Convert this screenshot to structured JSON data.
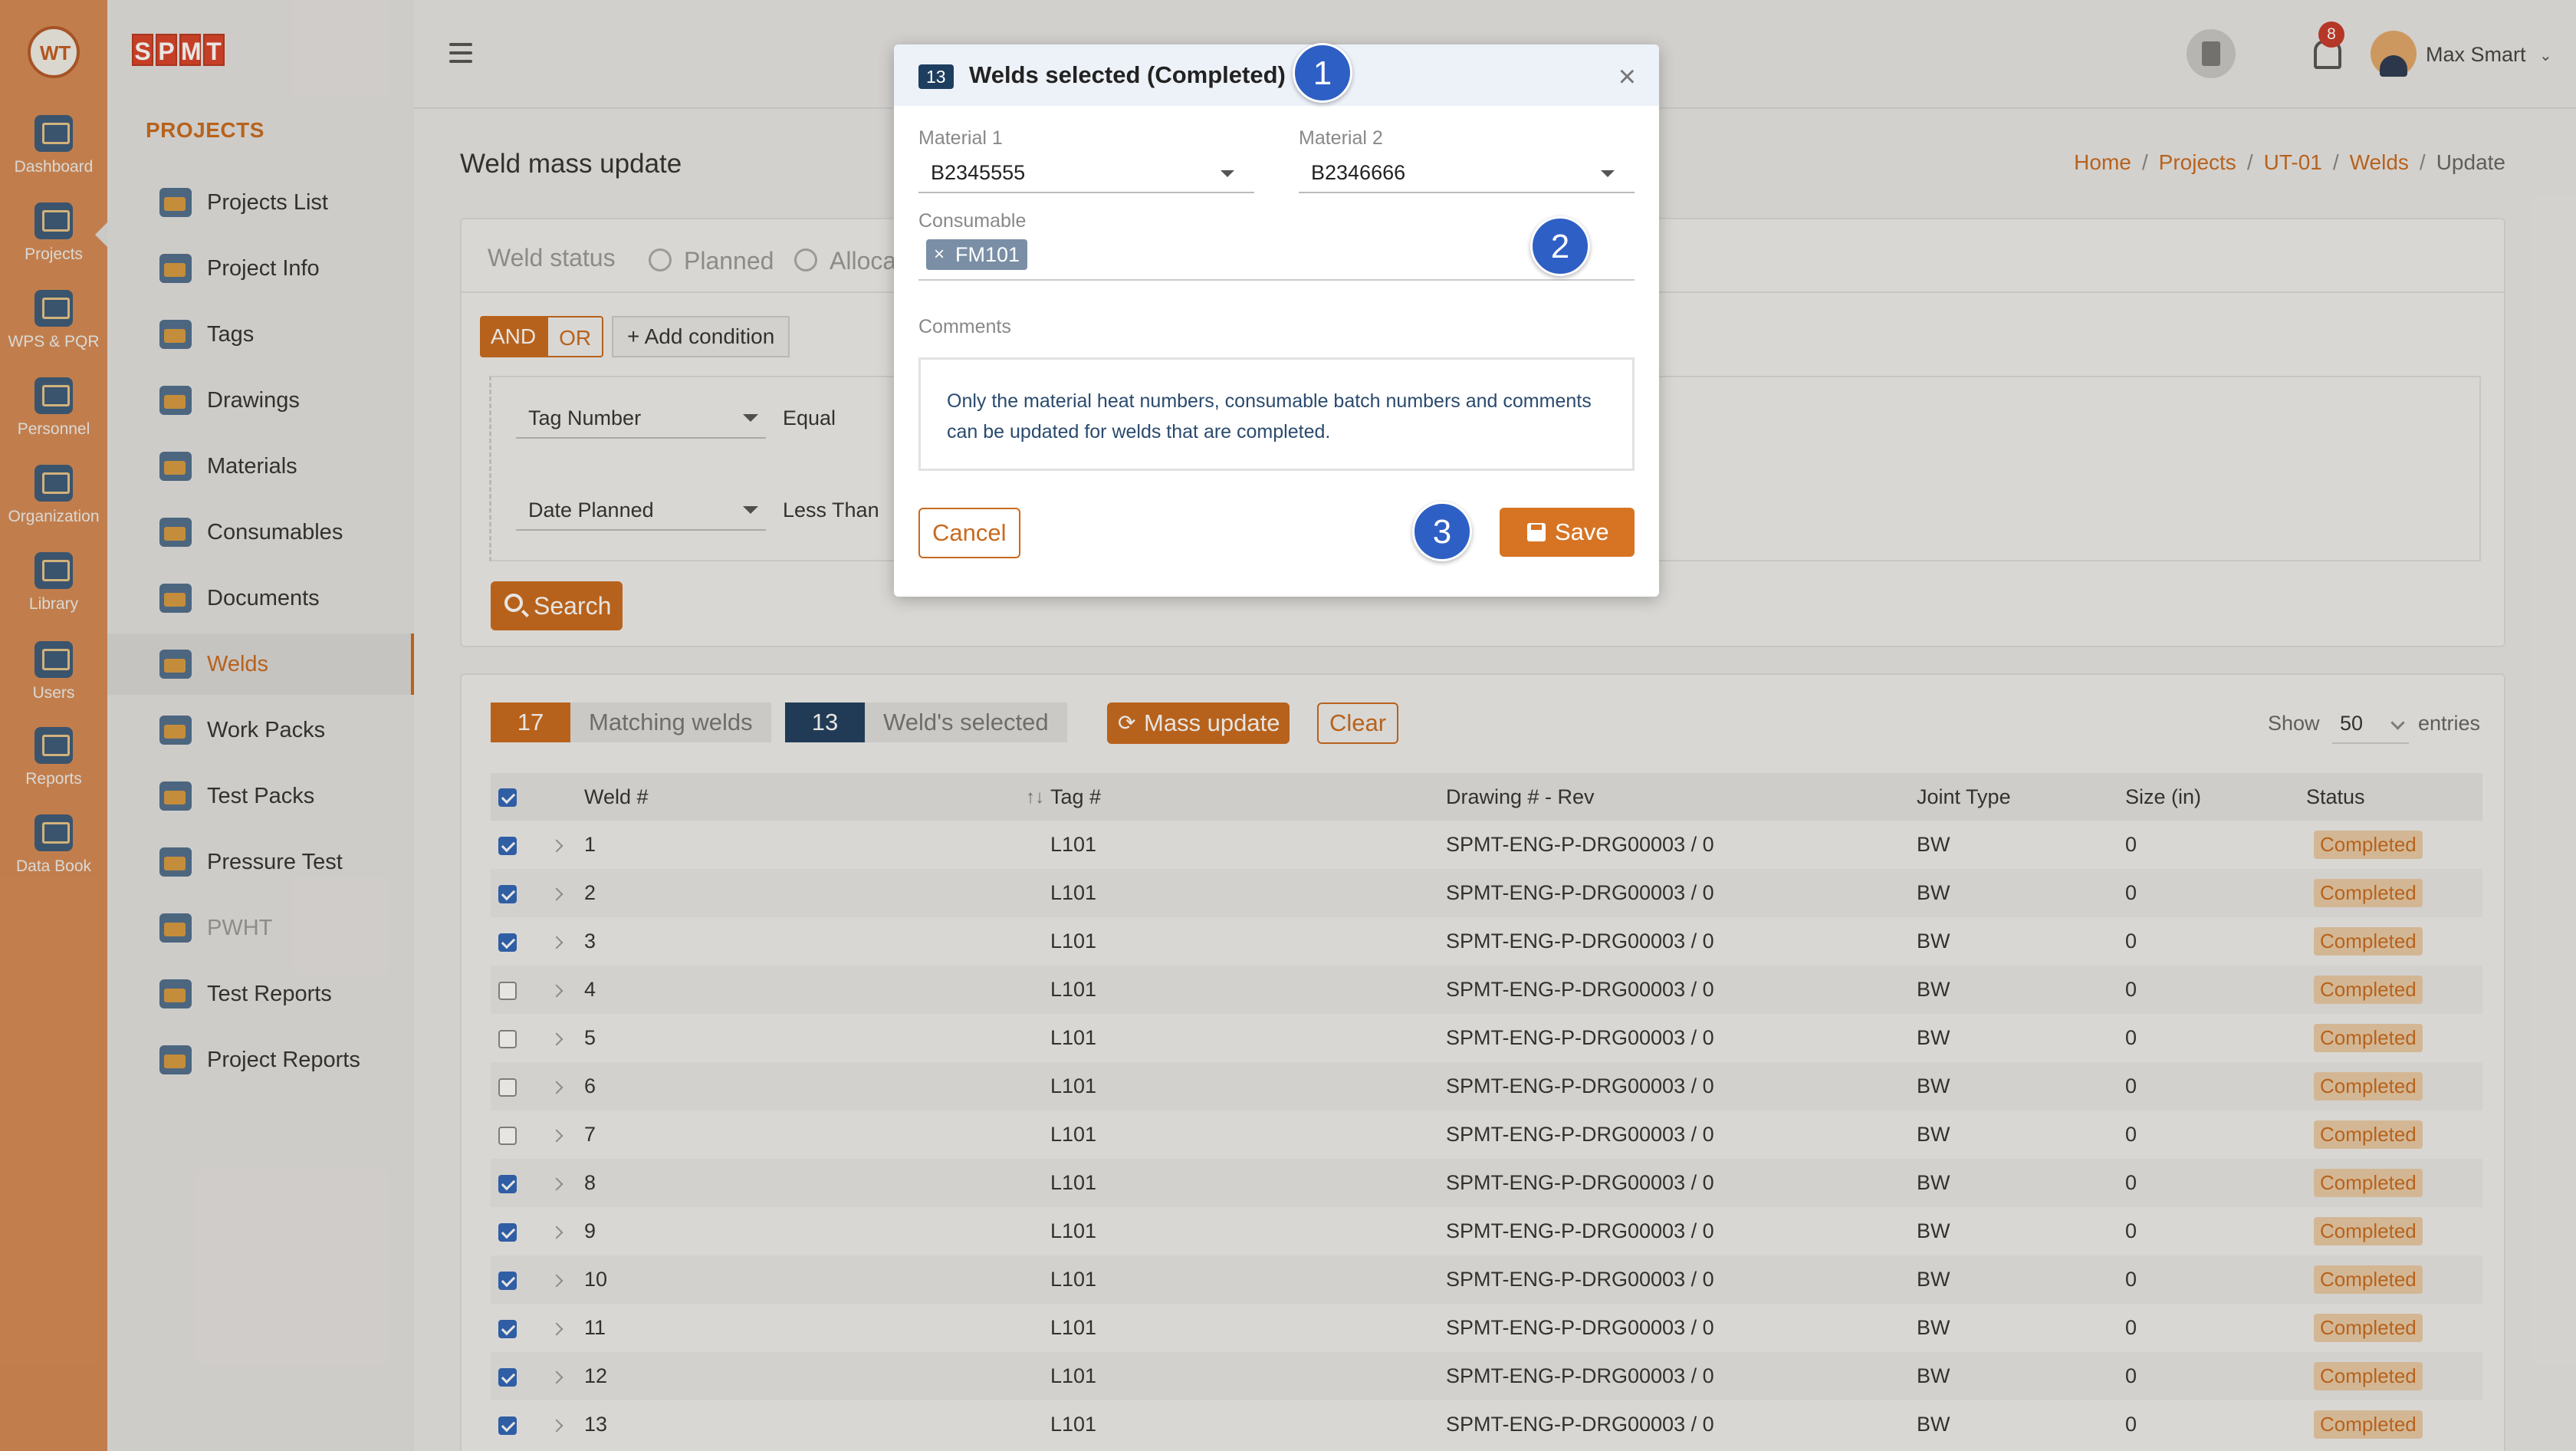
{
  "rail": [
    {
      "label": "Dashboard",
      "icon": "dashboard-icon"
    },
    {
      "label": "Projects",
      "icon": "projects-icon"
    },
    {
      "label": "WPS & PQR",
      "icon": "wps-pqr-icon"
    },
    {
      "label": "Personnel",
      "icon": "personnel-icon"
    },
    {
      "label": "Organization",
      "icon": "organization-icon"
    },
    {
      "label": "Library",
      "icon": "library-icon"
    },
    {
      "label": "Users",
      "icon": "users-icon"
    },
    {
      "label": "Reports",
      "icon": "reports-icon"
    },
    {
      "label": "Data Book",
      "icon": "data-book-icon"
    }
  ],
  "rail_logo": "WT",
  "brand": [
    "S",
    "P",
    "M",
    "T"
  ],
  "sidebar": {
    "section": "PROJECTS",
    "items": [
      {
        "label": "Projects List"
      },
      {
        "label": "Project Info"
      },
      {
        "label": "Tags"
      },
      {
        "label": "Drawings"
      },
      {
        "label": "Materials"
      },
      {
        "label": "Consumables"
      },
      {
        "label": "Documents"
      },
      {
        "label": "Welds"
      },
      {
        "label": "Work Packs"
      },
      {
        "label": "Test Packs"
      },
      {
        "label": "Pressure Test"
      },
      {
        "label": "PWHT"
      },
      {
        "label": "Test Reports"
      },
      {
        "label": "Project Reports"
      }
    ]
  },
  "topbar": {
    "notifications": "8",
    "user": "Max Smart"
  },
  "page": {
    "title": "Weld mass update",
    "breadcrumb": [
      "Home",
      "Projects",
      "UT-01",
      "Welds",
      "Update"
    ]
  },
  "filter": {
    "label": "Weld status",
    "radio1": "Planned",
    "radio2": "Alloca",
    "and": "AND",
    "or": "OR",
    "add_condition": "+ Add condition",
    "cond1_field": "Tag Number",
    "cond1_op": "Equal",
    "cond2_field": "Date Planned",
    "cond2_op": "Less Than",
    "search": "Search"
  },
  "results": {
    "matching_count": "17",
    "matching_label": "Matching welds",
    "selected_count": "13",
    "selected_label": "Weld's selected",
    "mass_update": "Mass update",
    "clear": "Clear",
    "show": "Show",
    "show_value": "50",
    "entries": "entries",
    "columns": [
      "Weld #",
      "Tag #",
      "Drawing # - Rev",
      "Joint Type",
      "Size (in)",
      "Status"
    ],
    "rows": [
      {
        "checked": true,
        "weld": "1",
        "tag": "L101",
        "drawing": "SPMT-ENG-P-DRG00003 / 0",
        "joint": "BW",
        "size": "0",
        "status": "Completed"
      },
      {
        "checked": true,
        "weld": "2",
        "tag": "L101",
        "drawing": "SPMT-ENG-P-DRG00003 / 0",
        "joint": "BW",
        "size": "0",
        "status": "Completed"
      },
      {
        "checked": true,
        "weld": "3",
        "tag": "L101",
        "drawing": "SPMT-ENG-P-DRG00003 / 0",
        "joint": "BW",
        "size": "0",
        "status": "Completed"
      },
      {
        "checked": false,
        "weld": "4",
        "tag": "L101",
        "drawing": "SPMT-ENG-P-DRG00003 / 0",
        "joint": "BW",
        "size": "0",
        "status": "Completed"
      },
      {
        "checked": false,
        "weld": "5",
        "tag": "L101",
        "drawing": "SPMT-ENG-P-DRG00003 / 0",
        "joint": "BW",
        "size": "0",
        "status": "Completed"
      },
      {
        "checked": false,
        "weld": "6",
        "tag": "L101",
        "drawing": "SPMT-ENG-P-DRG00003 / 0",
        "joint": "BW",
        "size": "0",
        "status": "Completed"
      },
      {
        "checked": false,
        "weld": "7",
        "tag": "L101",
        "drawing": "SPMT-ENG-P-DRG00003 / 0",
        "joint": "BW",
        "size": "0",
        "status": "Completed"
      },
      {
        "checked": true,
        "weld": "8",
        "tag": "L101",
        "drawing": "SPMT-ENG-P-DRG00003 / 0",
        "joint": "BW",
        "size": "0",
        "status": "Completed"
      },
      {
        "checked": true,
        "weld": "9",
        "tag": "L101",
        "drawing": "SPMT-ENG-P-DRG00003 / 0",
        "joint": "BW",
        "size": "0",
        "status": "Completed"
      },
      {
        "checked": true,
        "weld": "10",
        "tag": "L101",
        "drawing": "SPMT-ENG-P-DRG00003 / 0",
        "joint": "BW",
        "size": "0",
        "status": "Completed"
      },
      {
        "checked": true,
        "weld": "11",
        "tag": "L101",
        "drawing": "SPMT-ENG-P-DRG00003 / 0",
        "joint": "BW",
        "size": "0",
        "status": "Completed"
      },
      {
        "checked": true,
        "weld": "12",
        "tag": "L101",
        "drawing": "SPMT-ENG-P-DRG00003 / 0",
        "joint": "BW",
        "size": "0",
        "status": "Completed"
      },
      {
        "checked": true,
        "weld": "13",
        "tag": "L101",
        "drawing": "SPMT-ENG-P-DRG00003 / 0",
        "joint": "BW",
        "size": "0",
        "status": "Completed"
      }
    ]
  },
  "modal": {
    "count": "13",
    "title": "Welds selected (Completed)",
    "close": "×",
    "material1_label": "Material 1",
    "material1_value": "B2345555",
    "material2_label": "Material 2",
    "material2_value": "B2346666",
    "consumable_label": "Consumable",
    "consumable_chip": "FM101",
    "comments_label": "Comments",
    "comments_text": "Only the material heat numbers, consumable batch numbers and comments can be updated for welds that are completed.",
    "cancel": "Cancel",
    "save": "Save"
  },
  "steps": [
    "1",
    "2",
    "3"
  ],
  "colors": {
    "accent": "#c96a1e",
    "rail": "#d48a55",
    "step": "#2e5fc4",
    "navy": "#1e3e60"
  }
}
